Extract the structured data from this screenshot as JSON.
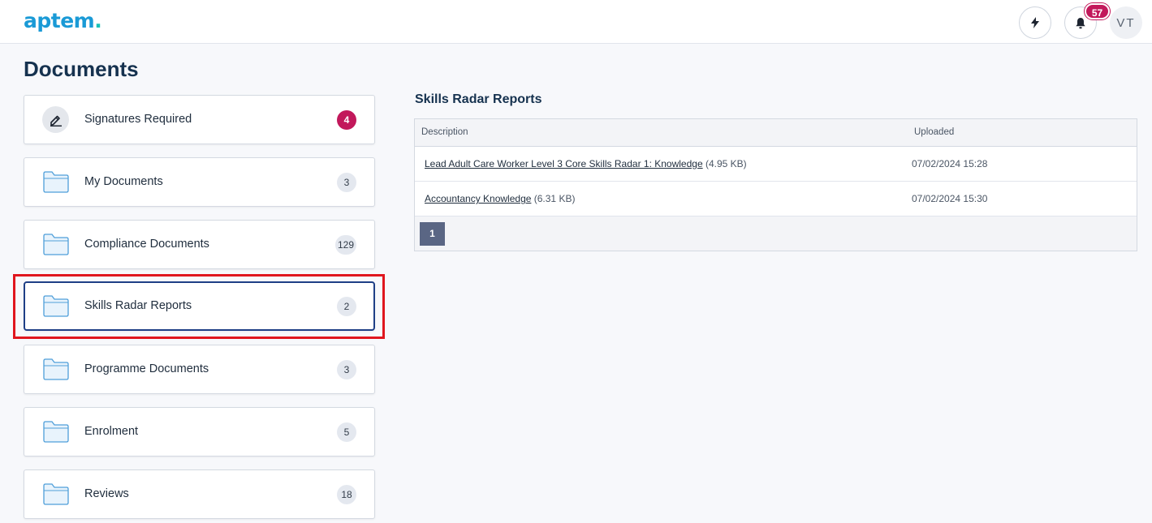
{
  "app": {
    "logo_main": "aptem",
    "logo_dot": ".",
    "notification_count": "57",
    "avatar_initials": "VT",
    "icons": {
      "quick_actions": "bolt-icon",
      "notifications": "bell-icon"
    }
  },
  "page": {
    "title": "Documents"
  },
  "folders": [
    {
      "label": "Signatures Required",
      "count": "4",
      "icon": "signature-icon",
      "alert": true
    },
    {
      "label": "My Documents",
      "count": "3",
      "icon": "folder-icon"
    },
    {
      "label": "Compliance Documents",
      "count": "129",
      "icon": "folder-icon"
    },
    {
      "label": "Skills Radar Reports",
      "count": "2",
      "icon": "folder-icon",
      "selected": true
    },
    {
      "label": "Programme Documents",
      "count": "3",
      "icon": "folder-icon"
    },
    {
      "label": "Enrolment",
      "count": "5",
      "icon": "folder-icon"
    },
    {
      "label": "Reviews",
      "count": "18",
      "icon": "folder-icon"
    }
  ],
  "reports": {
    "title": "Skills Radar Reports",
    "columns": {
      "description": "Description",
      "uploaded": "Uploaded"
    },
    "rows": [
      {
        "name": "Lead Adult Care Worker Level 3 Core Skills Radar 1: Knowledge",
        "size": " (4.95 KB)",
        "uploaded": "07/02/2024 15:28"
      },
      {
        "name": "Accountancy Knowledge",
        "size": " (6.31 KB)",
        "uploaded": "07/02/2024 15:30"
      }
    ],
    "pagination": {
      "current_page": "1"
    }
  },
  "colors": {
    "brand": "#1a9ad6",
    "alert_badge": "#c2185b",
    "selected_border": "#1e3f86",
    "highlight_box": "#e0161e",
    "pager_active": "#5a6684"
  }
}
